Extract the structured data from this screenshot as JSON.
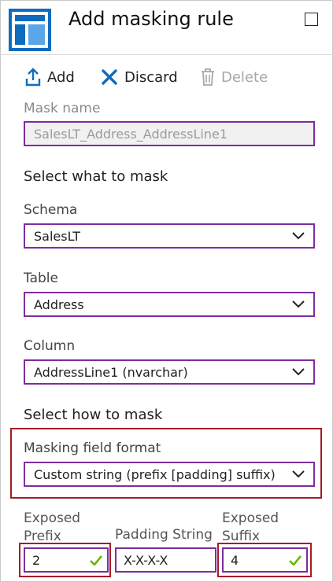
{
  "header": {
    "title": "Add masking rule"
  },
  "toolbar": {
    "add_label": "Add",
    "discard_label": "Discard",
    "delete_label": "Delete"
  },
  "form": {
    "mask_name": {
      "label": "Mask name",
      "value": "SalesLT_Address_AddressLine1"
    },
    "select_what_heading": "Select what to mask",
    "schema": {
      "label": "Schema",
      "value": "SalesLT"
    },
    "table": {
      "label": "Table",
      "value": "Address"
    },
    "column": {
      "label": "Column",
      "value": "AddressLine1 (nvarchar)"
    },
    "select_how_heading": "Select how to mask",
    "masking_format": {
      "label": "Masking field format",
      "value": "Custom string (prefix [padding] suffix)"
    },
    "exposed_prefix": {
      "label_line1": "Exposed",
      "label_line2": "Prefix",
      "value": "2"
    },
    "padding_string": {
      "label": "Padding String",
      "value": "X-X-X-X"
    },
    "exposed_suffix": {
      "label_line1": "Exposed",
      "label_line2": "Suffix",
      "value": "4"
    }
  },
  "colors": {
    "field_border": "#7e2ca0",
    "highlight_border": "#a51c24",
    "accent_blue": "#0f6cbd",
    "valid_green": "#6bb700"
  }
}
